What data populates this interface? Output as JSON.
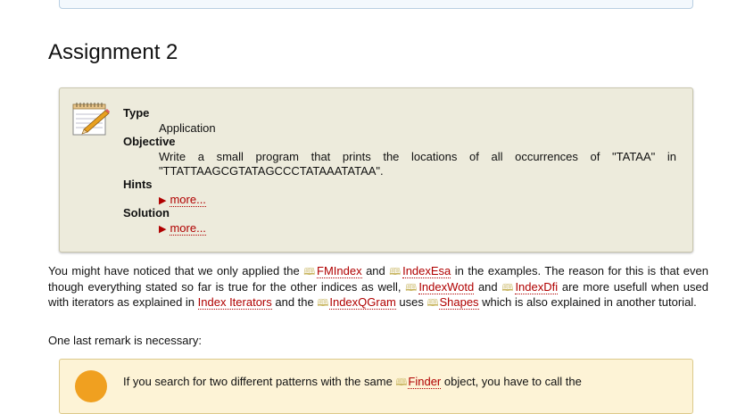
{
  "heading": "Assignment 2",
  "assignment": {
    "type_label": "Type",
    "type_value": "Application",
    "objective_label": "Objective",
    "objective_line1": "Write a small program that prints the locations of all occurrences of \"TATAA\" in",
    "objective_line2": "\"TTATTAAGCGTATAGCCCTATAAATATAA\".",
    "hints_label": "Hints",
    "hints_more": "more...",
    "solution_label": "Solution",
    "solution_more": "more..."
  },
  "paragraph1": {
    "t1": "You might have noticed that we only applied the ",
    "fmindex": "FMIndex",
    "t2": " and ",
    "indexesa": "IndexEsa",
    "t3": " in the examples. The reason for this is that even though everything stated so far is true for the other indices as well, ",
    "indexwotd": "IndexWotd",
    "t4": " and ",
    "indexdfi": "IndexDfi",
    "t5": " are more usefull when used with iterators as explained in ",
    "index_iterators": "Index Iterators",
    "t6": " and the ",
    "indexqgram": "IndexQGram",
    "t7": " uses ",
    "shapes": "Shapes",
    "t8": " which is also explained in another tutorial."
  },
  "paragraph2": "One last remark is necessary:",
  "warning": {
    "t1": "If you search for two different patterns with the same ",
    "finder": "Finder",
    "t2": " object, you have to call the"
  },
  "colors": {
    "link": "#b00000",
    "assignment_bg": "#edebdc",
    "warning_bg": "#fdf3d6"
  },
  "icons": [
    "notepad-pencil-icon",
    "book-icon",
    "warning-icon"
  ]
}
